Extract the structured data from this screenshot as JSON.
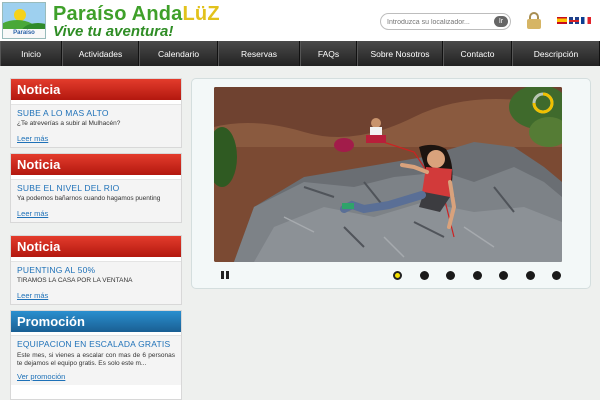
{
  "header": {
    "logo_caption": "Paraíso Andalüz",
    "brand_prefix": "Paraíso Anda",
    "brand_accent": "LüZ",
    "tagline": "Vive tu aventura!",
    "search_placeholder": "Introduzca su localizador...",
    "search_button": "Ir",
    "languages": [
      "es",
      "en",
      "fr"
    ]
  },
  "nav": {
    "items": [
      "Inicio",
      "Actividades",
      "Calendario",
      "Reservas",
      "FAQs",
      "Sobre Nosotros",
      "Contacto",
      "Descripción"
    ]
  },
  "sidebar": {
    "cards": [
      {
        "heading": "Noticia",
        "title": "SUBE A LO MAS ALTO",
        "text": "¿Te atreverías a subir al Mulhacén?",
        "link": "Leer más"
      },
      {
        "heading": "Noticia",
        "title": "SUBE EL NIVEL DEL RIO",
        "text": "Ya podemos bañarnos cuando hagamos puenting",
        "link": "Leer más"
      },
      {
        "heading": "Noticia",
        "title": "PUENTING AL 50%",
        "text": "TIRAMOS LA CASA POR LA VENTANA",
        "link": "Leer más"
      },
      {
        "heading": "Promoción",
        "title": "EQUIPACION EN ESCALADA GRATIS",
        "text": "Este mes, si vienes a escalar con mas de 6 personas te dejamos el equipo gratis. Es solo este m...",
        "link": "Ver promoción"
      }
    ]
  },
  "slider": {
    "slide_count": 7,
    "active_index": 0
  },
  "colors": {
    "brand_green": "#3fa02a",
    "news_red": "#c8231a",
    "promo_blue": "#1f7bb7",
    "link_blue": "#1e71b8",
    "active_dot": "#f5e100"
  }
}
